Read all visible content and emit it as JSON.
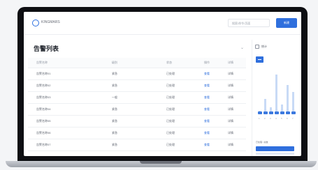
{
  "header": {
    "brand": "KINGMARS",
    "search_placeholder": "搜索/命令/页面",
    "primary_button": "新建"
  },
  "main": {
    "title": "告警列表",
    "table": {
      "headers": [
        "告警名称",
        "级别",
        "状态",
        "操作",
        "详情"
      ],
      "rows": [
        [
          "告警名称01",
          "紧急",
          "已处理",
          "查看",
          "详情"
        ],
        [
          "告警名称02",
          "紧急",
          "已处理",
          "查看",
          "详情"
        ],
        [
          "告警名称03",
          "一般",
          "已处理",
          "查看",
          "详情"
        ],
        [
          "告警名称04",
          "紧急",
          "已处理",
          "查看",
          "详情"
        ],
        [
          "告警名称05",
          "紧急",
          "已处理",
          "查看",
          "详情"
        ],
        [
          "告警名称06",
          "紧急",
          "已处理",
          "查看",
          "详情"
        ],
        [
          "告警名称07",
          "紧急",
          "已处理",
          "查看",
          "详情"
        ]
      ]
    }
  },
  "side": {
    "title": "统计",
    "chart": {
      "x": [
        "1",
        "2",
        "3",
        "4",
        "5",
        "6",
        "7"
      ],
      "values": [
        3,
        20,
        8,
        55,
        12,
        40,
        30
      ],
      "ymax": 60
    },
    "footer_label": "已处理 / 总数"
  }
}
